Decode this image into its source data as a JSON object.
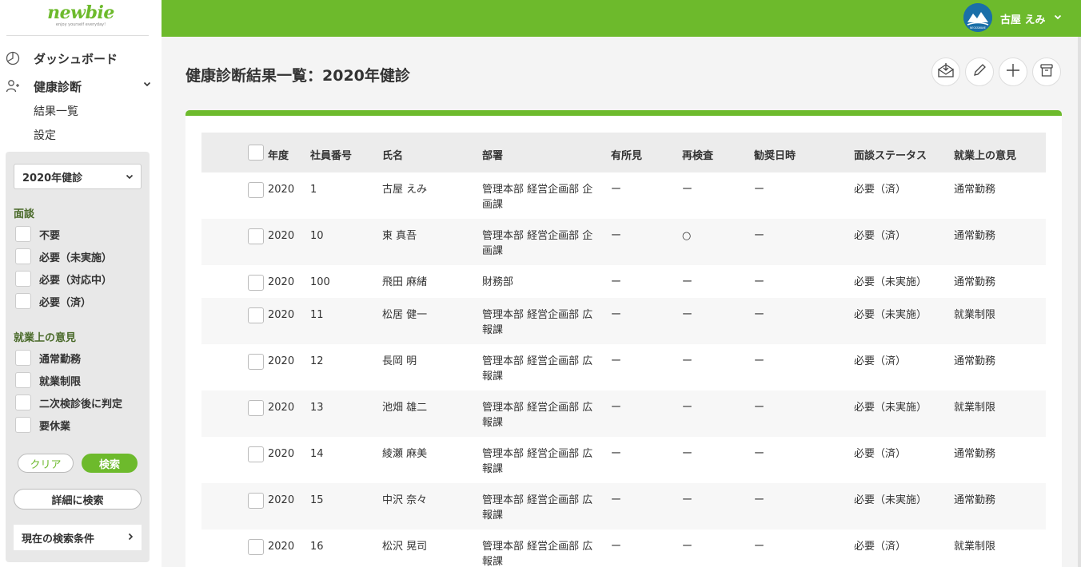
{
  "brand": {
    "name": "newbie",
    "tagline": "enjoy yourself everyday!"
  },
  "user": {
    "name": "古屋 えみ",
    "avatar_label": "NECKSWAVE"
  },
  "nav": {
    "dashboard": "ダッシュボード",
    "health": "健康診断",
    "sub": [
      "結果一覧",
      "設定"
    ]
  },
  "filters": {
    "selected_exam": "2020年健診",
    "interview_heading": "面談",
    "interview_options": [
      "不要",
      "必要（未実施）",
      "必要（対応中）",
      "必要（済）"
    ],
    "opinion_heading": "就業上の意見",
    "opinion_options": [
      "通常勤務",
      "就業制限",
      "二次検診後に判定",
      "要休業"
    ],
    "clear_label": "クリア",
    "search_label": "検索",
    "detail_label": "詳細に検索",
    "current_label": "現在の検索条件"
  },
  "page": {
    "title": "健康診断結果一覧：2020年健診"
  },
  "table": {
    "headers": [
      "年度",
      "社員番号",
      "氏名",
      "部署",
      "有所見",
      "再検査",
      "勧奨日時",
      "面談ステータス",
      "就業上の意見"
    ],
    "rows": [
      {
        "year": "2020",
        "id": "1",
        "name": "古屋 えみ",
        "dept": [
          "管理本部 経営企画部 企",
          "画課"
        ],
        "finding": "ー",
        "recheck": "ー",
        "date": "ー",
        "status": "必要（済）",
        "opinion": "通常勤務"
      },
      {
        "year": "2020",
        "id": "10",
        "name": "東 真吾",
        "dept": [
          "管理本部 経営企画部 企",
          "画課"
        ],
        "finding": "ー",
        "recheck": "○",
        "date": "ー",
        "status": "必要（済）",
        "opinion": "通常勤務"
      },
      {
        "year": "2020",
        "id": "100",
        "name": "飛田 麻緒",
        "dept": [
          "財務部",
          ""
        ],
        "finding": "ー",
        "recheck": "ー",
        "date": "ー",
        "status": "必要（未実施）",
        "opinion": "通常勤務"
      },
      {
        "year": "2020",
        "id": "11",
        "name": "松居 健一",
        "dept": [
          "管理本部 経営企画部 広",
          "報課"
        ],
        "finding": "ー",
        "recheck": "ー",
        "date": "ー",
        "status": "必要（未実施）",
        "opinion": "就業制限"
      },
      {
        "year": "2020",
        "id": "12",
        "name": "長岡 明",
        "dept": [
          "管理本部 経営企画部 広",
          "報課"
        ],
        "finding": "ー",
        "recheck": "ー",
        "date": "ー",
        "status": "必要（済）",
        "opinion": "通常勤務"
      },
      {
        "year": "2020",
        "id": "13",
        "name": "池畑 雄二",
        "dept": [
          "管理本部 経営企画部 広",
          "報課"
        ],
        "finding": "ー",
        "recheck": "ー",
        "date": "ー",
        "status": "必要（未実施）",
        "opinion": "就業制限"
      },
      {
        "year": "2020",
        "id": "14",
        "name": "綾瀬 麻美",
        "dept": [
          "管理本部 経営企画部 広",
          "報課"
        ],
        "finding": "ー",
        "recheck": "ー",
        "date": "ー",
        "status": "必要（済）",
        "opinion": "通常勤務"
      },
      {
        "year": "2020",
        "id": "15",
        "name": "中沢 奈々",
        "dept": [
          "管理本部 経営企画部 広",
          "報課"
        ],
        "finding": "ー",
        "recheck": "ー",
        "date": "ー",
        "status": "必要（未実施）",
        "opinion": "通常勤務"
      },
      {
        "year": "2020",
        "id": "16",
        "name": "松沢 晃司",
        "dept": [
          "管理本部 経営企画部 広",
          "報課"
        ],
        "finding": "ー",
        "recheck": "ー",
        "date": "ー",
        "status": "必要（済）",
        "opinion": "就業制限"
      }
    ]
  },
  "colors": {
    "accent": "#6dba2c",
    "avatar": "#1a6fa8"
  },
  "icons": {
    "actions": [
      "mail-download-icon",
      "pencil-icon",
      "plus-icon",
      "trash-icon"
    ]
  }
}
